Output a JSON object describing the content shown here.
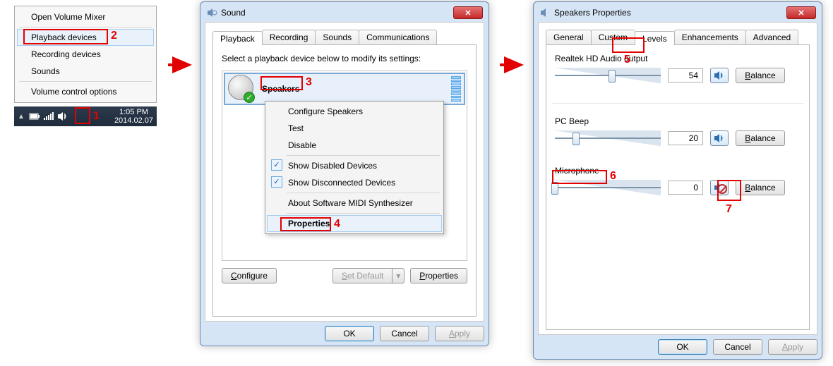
{
  "tray_menu": {
    "open_mixer": "Open Volume Mixer",
    "playback": "Playback devices",
    "recording": "Recording devices",
    "sounds": "Sounds",
    "options": "Volume control options"
  },
  "taskbar": {
    "time": "1:05 PM",
    "date": "2014.02.07"
  },
  "sound": {
    "title": "Sound",
    "tabs": {
      "playback": "Playback",
      "recording": "Recording",
      "sounds": "Sounds",
      "communications": "Communications"
    },
    "prompt": "Select a playback device below to modify its settings:",
    "device_name": "Speakers",
    "context": {
      "configure": "Configure Speakers",
      "test": "Test",
      "disable": "Disable",
      "show_disabled": "Show Disabled Devices",
      "show_disconnected": "Show Disconnected Devices",
      "about_midi": "About Software MIDI Synthesizer",
      "properties": "Properties"
    },
    "buttons": {
      "configure": "Configure",
      "set_default": "Set Default",
      "properties": "Properties",
      "ok": "OK",
      "cancel": "Cancel",
      "apply": "Apply"
    }
  },
  "props": {
    "title": "Speakers Properties",
    "tabs": {
      "general": "General",
      "custom": "Custom",
      "levels": "Levels",
      "enhancements": "Enhancements",
      "advanced": "Advanced"
    },
    "realtek": {
      "label": "Realtek HD Audio output",
      "value": "54",
      "pct": 54,
      "muted": false
    },
    "pcbeep": {
      "label": "PC Beep",
      "value": "20",
      "pct": 20,
      "muted": false
    },
    "mic": {
      "label": "Microphone",
      "value": "0",
      "pct": 0,
      "muted": true
    },
    "balance": "Balance",
    "buttons": {
      "ok": "OK",
      "cancel": "Cancel",
      "apply": "Apply"
    }
  },
  "annotations": {
    "n1": "1",
    "n2": "2",
    "n3": "3",
    "n4": "4",
    "n5": "5",
    "n6": "6",
    "n7": "7"
  }
}
